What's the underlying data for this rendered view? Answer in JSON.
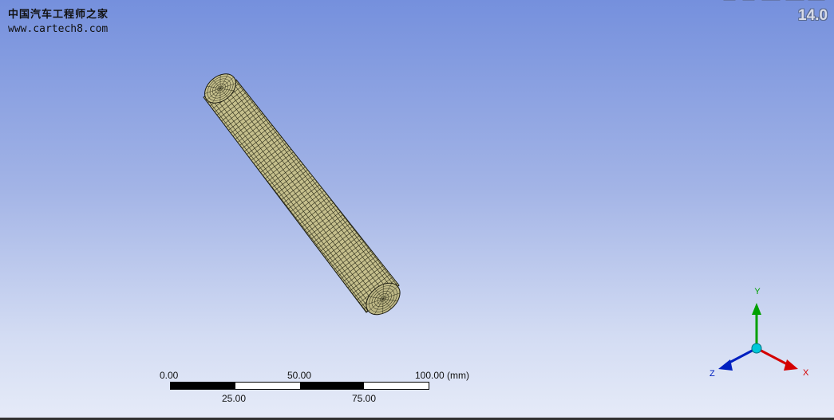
{
  "watermark": {
    "site_name": "中国汽车工程师之家",
    "url": "www.cartech8.com"
  },
  "version": "14.0",
  "scale_bar": {
    "top_labels": [
      "0.00",
      "50.00",
      "100.00 (mm)"
    ],
    "bottom_labels": [
      "25.00",
      "75.00"
    ]
  },
  "triad": {
    "x_label": "X",
    "y_label": "Y",
    "z_label": "Z",
    "x_color": "#d40000",
    "y_color": "#00a000",
    "z_color": "#0020c0",
    "origin_color": "#00c8d8"
  },
  "model": {
    "name": "meshed-cylinder",
    "surface_color": "#c8c290",
    "mesh_line_color": "#1a1a10"
  },
  "colors": {
    "background_top": "#7590dd",
    "background_bottom": "#e6ebf8"
  }
}
